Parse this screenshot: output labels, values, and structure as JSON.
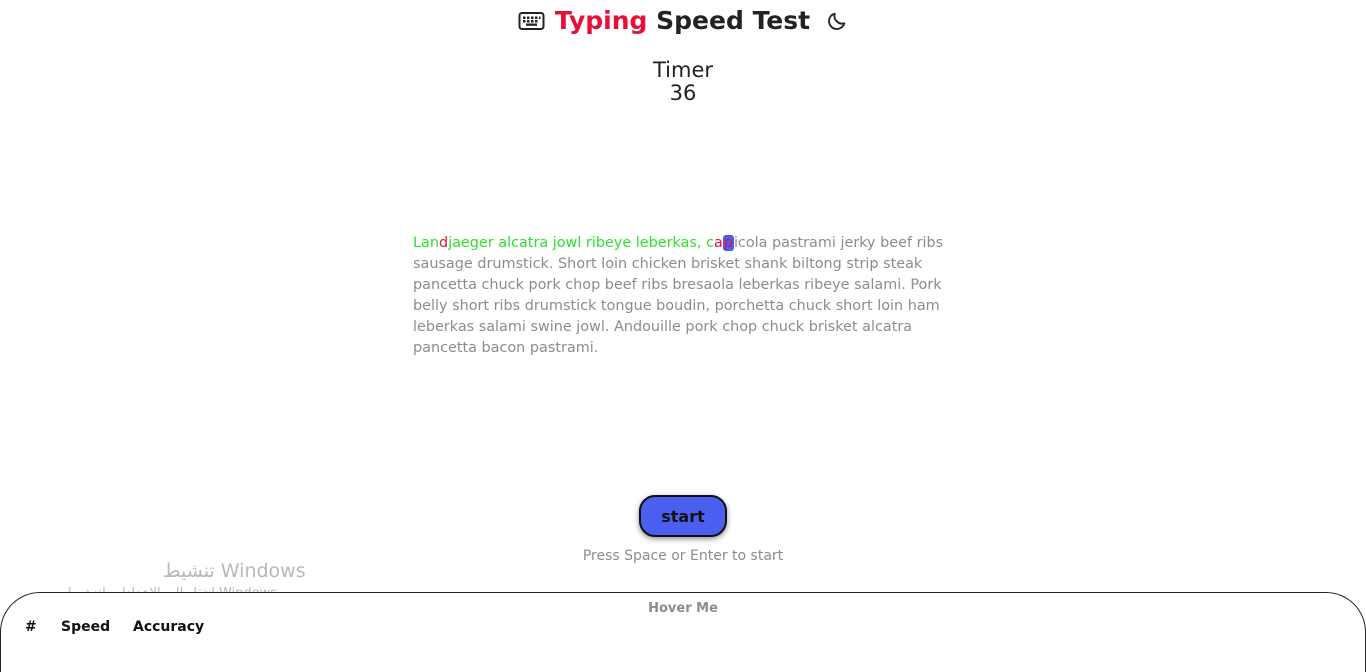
{
  "header": {
    "title_accent": "Typing",
    "title_rest": " Speed Test",
    "keyboard_icon": "keyboard-icon",
    "theme_icon": "moon-icon",
    "accent_color": "#e60f36"
  },
  "timer": {
    "label": "Timer",
    "value": "36"
  },
  "passage": {
    "typed_1": "Lan",
    "error_1": "d",
    "typed_2": "jaeger alcatra jowl ribeye leberkas, c",
    "error_2": "a",
    "current_char": "p",
    "remaining": "icola pastrami jerky beef ribs sausage drumstick. Short loin chicken brisket shank biltong strip steak pancetta chuck pork chop beef ribs bresaola leberkas ribeye salami. Pork belly short ribs drumstick tongue boudin, porchetta chuck short loin ham leberkas salami swine jowl. Andouille pork chop chuck brisket alcatra pancetta bacon pastrami.",
    "correct_color": "#2ee02e",
    "cursor_color": "#4a5ff0"
  },
  "controls": {
    "start_label": "start",
    "hint": "Press Space or Enter to start"
  },
  "watermark": {
    "line1": "تنشيط Windows",
    "line2": "انتقل إلى الإعدادات لتنشيط Windows."
  },
  "history": {
    "hover_label": "Hover Me",
    "columns": [
      "#",
      "Speed",
      "Accuracy"
    ]
  }
}
